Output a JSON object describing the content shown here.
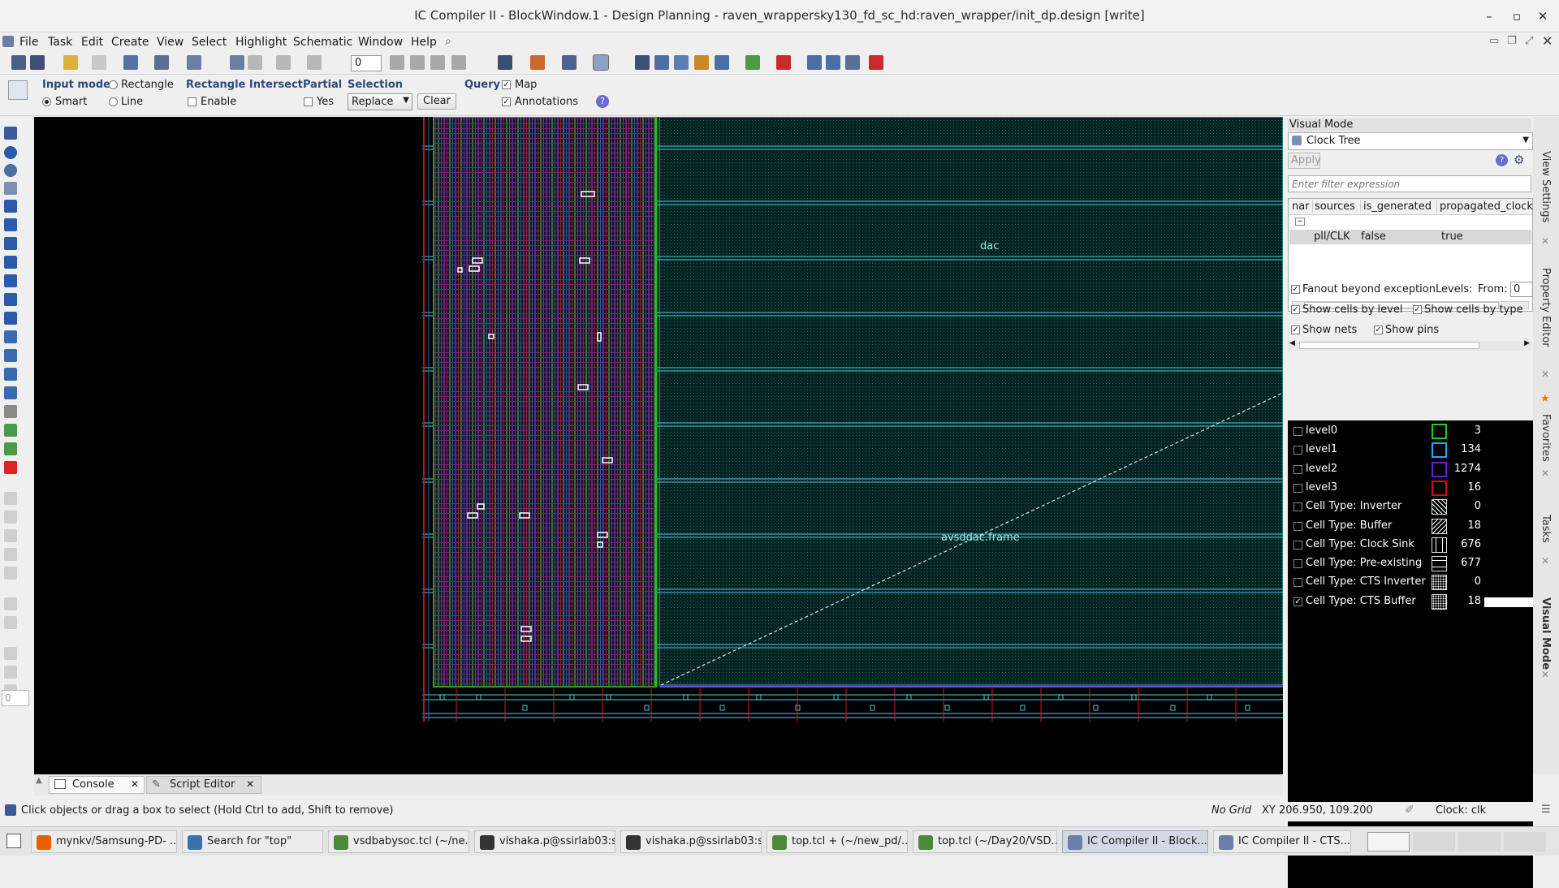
{
  "window": {
    "title": "IC Compiler II - BlockWindow.1 - Design Planning - raven_wrappersky130_fd_sc_hd:raven_wrapper/init_dp.design [write]"
  },
  "menu": [
    "File",
    "Task",
    "Edit",
    "Create",
    "View",
    "Select",
    "Highlight",
    "Schematic",
    "Window",
    "Help"
  ],
  "toolbar": {
    "spin_value": "0"
  },
  "options": {
    "input_mode_label": "Input mode",
    "smart_label": "Smart",
    "rectangle_label": "Rectangle",
    "line_label": "Line",
    "rect_intersect_label": "Rectangle Intersect",
    "enable_label": "Enable",
    "partial_label": "Partial",
    "yes_label": "Yes",
    "selection_label": "Selection",
    "selection_value": "Replace",
    "clear_label": "Clear",
    "query_label": "Query",
    "map_label": "Map",
    "annotations_label": "Annotations"
  },
  "canvas": {
    "labels": [
      "dac",
      "avsddac.frame"
    ],
    "spin_value": "0"
  },
  "visual_mode": {
    "header": "Visual Mode",
    "mode": "Clock Tree",
    "apply_label": "Apply",
    "filter_placeholder": "Enter filter expression",
    "columns": [
      "nar",
      "sources",
      "is_generated",
      "propagated_clock"
    ],
    "row": {
      "sources": "pll/CLK",
      "is_generated": "false",
      "propagated_clock": "true"
    },
    "fanout_label": "Fanout beyond exception",
    "levels_label": "Levels:",
    "from_label": "From:",
    "from_value": "0",
    "show_cells_by_level": "Show cells by level",
    "show_cells_by_type": "Show cells by type",
    "show_nets": "Show nets",
    "show_pins": "Show pins",
    "legend": [
      {
        "name": "level0",
        "count": "3",
        "color": "#22cc22",
        "checked": false
      },
      {
        "name": "level1",
        "count": "134",
        "color": "#22aaff",
        "checked": false
      },
      {
        "name": "level2",
        "count": "1274",
        "color": "#6a1bd8",
        "checked": false
      },
      {
        "name": "level3",
        "count": "16",
        "color": "#d01010",
        "checked": false
      },
      {
        "name": "Cell Type: Inverter",
        "count": "0",
        "pattern": "diag",
        "checked": false
      },
      {
        "name": "Cell Type: Buffer",
        "count": "18",
        "pattern": "diag2",
        "checked": false
      },
      {
        "name": "Cell Type: Clock Sink",
        "count": "676",
        "pattern": "vert",
        "checked": false
      },
      {
        "name": "Cell Type: Pre-existing",
        "count": "677",
        "pattern": "horiz",
        "checked": false
      },
      {
        "name": "Cell Type: CTS Inverter",
        "count": "0",
        "pattern": "dots",
        "checked": false
      },
      {
        "name": "Cell Type: CTS Buffer",
        "count": "18",
        "pattern": "dots",
        "checked": true
      }
    ]
  },
  "side_tabs": [
    "View Settings",
    "Property Editor",
    "Favorites",
    "Tasks",
    "Visual Mode"
  ],
  "bottom_tabs": {
    "console": "Console",
    "script_editor": "Script Editor"
  },
  "status": {
    "message": "Click objects or drag a box to select (Hold Ctrl to add, Shift to remove)",
    "grid": "No Grid",
    "coords": "XY 206.950, 109.200",
    "clock": "Clock: clk"
  },
  "taskbar": [
    {
      "label": "mynkv/Samsung-PD- ...",
      "icon": "#e66000"
    },
    {
      "label": "Search for \"top\"",
      "icon": "#3a6fb0"
    },
    {
      "label": "vsdbabysoc.tcl (~/ne...",
      "icon": "#4a8a3a"
    },
    {
      "label": "vishaka.p@ssirlab03:s...",
      "icon": "#333333"
    },
    {
      "label": "vishaka.p@ssirlab03:s...",
      "icon": "#333333"
    },
    {
      "label": "top.tcl + (~/new_pd/...",
      "icon": "#4a8a3a"
    },
    {
      "label": "top.tcl (~/Day20/VSD...",
      "icon": "#4a8a3a"
    },
    {
      "label": "IC Compiler II - Block...",
      "icon": "#6a7fa8"
    },
    {
      "label": "IC Compiler II - CTS...",
      "icon": "#6a7fa8"
    }
  ]
}
